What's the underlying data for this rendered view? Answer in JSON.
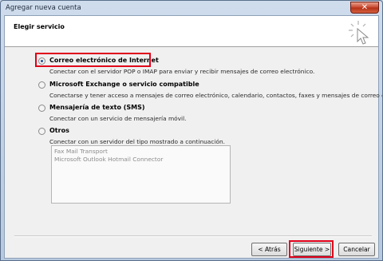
{
  "window": {
    "title": "Agregar nueva cuenta",
    "close_glyph": "✕"
  },
  "header": {
    "title": "Elegir servicio",
    "icon": "cursor-sparkle-icon"
  },
  "options": [
    {
      "label": "Correo electrónico de Internet",
      "description": "Conectar con el servidor POP o IMAP para enviar y recibir mensajes de correo electrónico.",
      "selected": true
    },
    {
      "label": "Microsoft Exchange o servicio compatible",
      "description": "Conectarse y tener acceso a mensajes de correo electrónico, calendario, contactos, faxes y mensajes de correo de voz.",
      "selected": false
    },
    {
      "label": "Mensajería de texto (SMS)",
      "description": "Conectar con un servicio de mensajería móvil.",
      "selected": false
    },
    {
      "label": "Otros",
      "description": "Conectar con un servidor del tipo mostrado a continuación.",
      "selected": false
    }
  ],
  "server_types": [
    "Fax Mail Transport",
    "Microsoft Outlook Hotmail Connector"
  ],
  "buttons": {
    "back": "< Atrás",
    "next": "Siguiente >",
    "cancel": "Cancelar"
  },
  "colors": {
    "highlight": "#e0001a",
    "radio_dot": "#1f4f9a"
  }
}
